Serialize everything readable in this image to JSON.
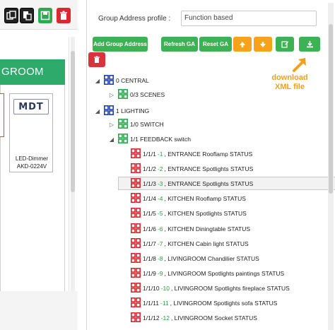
{
  "left": {
    "room_header": "GROOM",
    "device": {
      "logo": "MDT",
      "name": "LED-Dimmer",
      "model": "AKD-0224V"
    }
  },
  "profile": {
    "label": "Group Address profile :",
    "value": "Function based"
  },
  "buttons": {
    "add_group_address": "Add Group Address",
    "refresh_ga": "Refresh GA",
    "reset_ga": "Reset GA"
  },
  "annotation": {
    "line1": "download",
    "line2": "XML file"
  },
  "tree": {
    "central": "0 CENTRAL",
    "scenes": "0/3 SCENES",
    "lighting": "1 LIGHTING",
    "switch": "1/0 SWITCH",
    "feedback": "1/1 FEEDBACK switch",
    "items": [
      {
        "addr": "1/1/1",
        "num": "-1",
        "label": ", ENTRANCE Rooflamp STATUS"
      },
      {
        "addr": "1/1/2",
        "num": "-2",
        "label": ", ENTRANCE Spotlights STATUS"
      },
      {
        "addr": "1/1/3",
        "num": "-3",
        "label": ", ENTRANCE Spotlights STATUS"
      },
      {
        "addr": "1/1/4",
        "num": "-4",
        "label": ", KITCHEN Rooflamp STATUS"
      },
      {
        "addr": "1/1/5",
        "num": "-5",
        "label": ", KITCHEN Spotlights STATUS"
      },
      {
        "addr": "1/1/6",
        "num": "-6",
        "label": ", KITCHEN Diningtable STATUS"
      },
      {
        "addr": "1/1/7",
        "num": "-7",
        "label": ", KITCHEN Cabin light STATUS"
      },
      {
        "addr": "1/1/8",
        "num": "-8",
        "label": ", LIVINGROOM Chandilier STATUS"
      },
      {
        "addr": "1/1/9",
        "num": "-9",
        "label": ", LIVINGROOM Spotlights paintings STATUS"
      },
      {
        "addr": "1/1/10",
        "num": "-10",
        "label": ", LIVINGROOM Spotlights fireplace STATUS"
      },
      {
        "addr": "1/1/11",
        "num": "-11",
        "label": ", LIVINGROOM Spotlights sofa STATUS"
      },
      {
        "addr": "1/1/12",
        "num": "-12",
        "label": ", LIVINGROOM Socket STATUS"
      }
    ]
  },
  "colors": {
    "green": "#3fb155",
    "orange": "#f7a21b",
    "red": "#d9343b",
    "group_icon_blue": "#1f3fb5",
    "group_icon_green": "#2aa84a",
    "ga_icon_red": "#d9262e"
  }
}
